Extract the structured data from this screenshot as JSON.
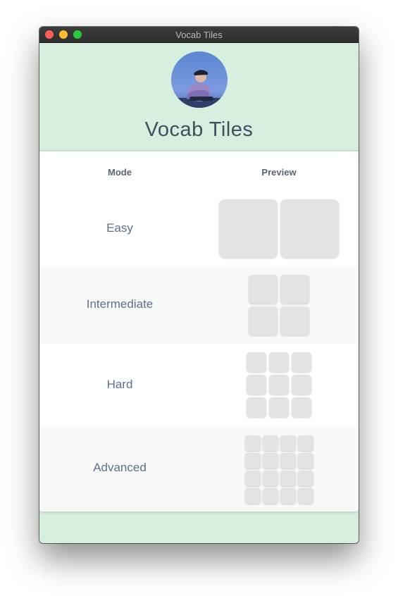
{
  "window": {
    "title": "Vocab Tiles"
  },
  "header": {
    "title": "Vocab Tiles",
    "avatar_icon": "profile-photo"
  },
  "table": {
    "columns": [
      "Mode",
      "Preview"
    ],
    "rows": [
      {
        "label": "Easy",
        "grid": "2x1"
      },
      {
        "label": "Intermediate",
        "grid": "2x2"
      },
      {
        "label": "Hard",
        "grid": "3x3"
      },
      {
        "label": "Advanced",
        "grid": "4x4"
      }
    ]
  },
  "colors": {
    "background": "#d7efde",
    "title_text": "#3a5260",
    "label_text": "#5f6f8a",
    "tile": "#e3e3e3"
  }
}
